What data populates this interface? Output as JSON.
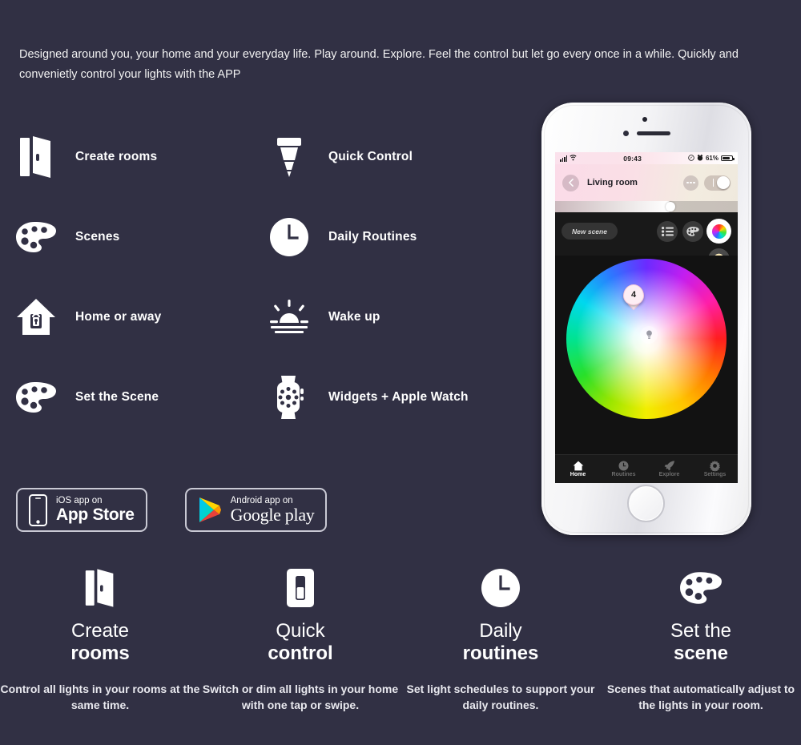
{
  "intro": {
    "text": "Designed around you, your home and your everyday life. Play around. Explore. Feel the control but let go every once in a while. Quickly and convenietly control your lights with the  APP"
  },
  "features": [
    {
      "icon": "open-door-icon",
      "label": "Create rooms"
    },
    {
      "icon": "light-bulb-icon",
      "label": "Quick Control"
    },
    {
      "icon": "paint-palette-icon",
      "label": "Scenes"
    },
    {
      "icon": "clock-icon",
      "label": "Daily Routines"
    },
    {
      "icon": "home-lock-icon",
      "label": "Home or away"
    },
    {
      "icon": "sunrise-icon",
      "label": "Wake up"
    },
    {
      "icon": "paint-palette-icon",
      "label": "Set the Scene"
    },
    {
      "icon": "apple-watch-icon",
      "label": "Widgets + Apple Watch"
    }
  ],
  "badges": [
    {
      "icon": "iphone-icon",
      "small": "iOS app on",
      "big": "App Store"
    },
    {
      "icon": "play-store-icon",
      "small": "Android app on",
      "big": "Google play"
    }
  ],
  "phone": {
    "statusbar": {
      "signal_icon": "signal-bars-icon",
      "wifi_icon": "wifi-icon",
      "time": "09:43",
      "location_icon": "location-arrow-icon",
      "alarm_icon": "alarm-icon",
      "battery_pct": "61%",
      "battery_icon": "battery-icon"
    },
    "header": {
      "back_icon": "chevron-left-icon",
      "title": "Living room",
      "more_icon": "more-dots-icon",
      "toggle_state": "on"
    },
    "toolbar": {
      "new_scene_label": "New scene",
      "list_icon": "list-icon",
      "palette_icon": "palette-icon",
      "color_wheel_icon": "color-wheel-icon",
      "bulb_icon": "bulb-pin-icon"
    },
    "colorwheel": {
      "pin_label": "4",
      "ghost_icon": "bulb-icon"
    },
    "tabs": [
      {
        "icon": "home-icon",
        "label": "Home",
        "active": true
      },
      {
        "icon": "clock-icon",
        "label": "Routines",
        "active": false
      },
      {
        "icon": "rocket-icon",
        "label": "Explore",
        "active": false
      },
      {
        "icon": "gear-icon",
        "label": "Settings",
        "active": false
      }
    ]
  },
  "cards": [
    {
      "icon": "open-door-icon",
      "title_line1": "Create",
      "title_line2": "rooms",
      "desc": "Control all lights in your rooms at the same time."
    },
    {
      "icon": "light-switch-icon",
      "title_line1": "Quick",
      "title_line2": "control",
      "desc": "Switch or dim all lights in your home with one tap or swipe."
    },
    {
      "icon": "clock-icon",
      "title_line1": "Daily",
      "title_line2": "routines",
      "desc": "Set light schedules to support your daily routines."
    },
    {
      "icon": "paint-palette-icon",
      "title_line1": "Set the",
      "title_line2": "scene",
      "desc": "Scenes that automatically adjust to the lights in your room."
    }
  ],
  "colors": {
    "background": "#313044",
    "text": "#ffffff",
    "phone_body": "#f2f2f5",
    "screen_dark": "#121212",
    "header_pink": "#fbdbe8"
  }
}
